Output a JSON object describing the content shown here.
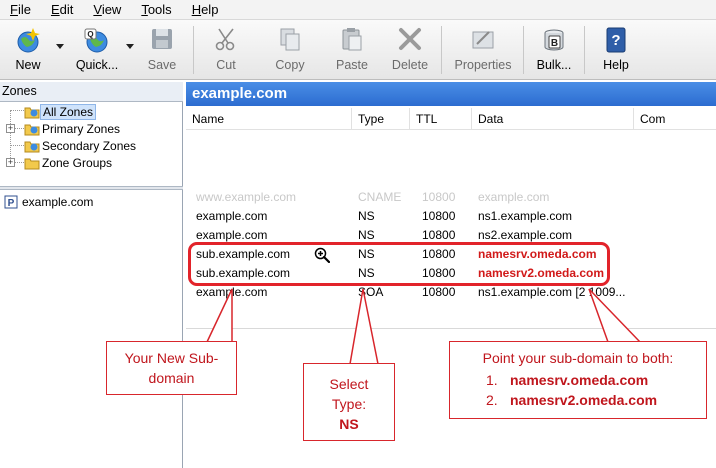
{
  "menu": [
    {
      "first": "F",
      "rest": "ile"
    },
    {
      "first": "E",
      "rest": "dit"
    },
    {
      "first": "V",
      "rest": "iew"
    },
    {
      "first": "T",
      "rest": "ools"
    },
    {
      "first": "H",
      "rest": "elp"
    }
  ],
  "toolbar": {
    "new": "New",
    "quick": "Quick...",
    "save": "Save",
    "cut": "Cut",
    "copy": "Copy",
    "paste": "Paste",
    "delete": "Delete",
    "properties": "Properties",
    "bulk": "Bulk...",
    "help": "Help"
  },
  "left": {
    "header": "Zones",
    "tree": {
      "all_zones": "All Zones",
      "primary_zones": "Primary Zones",
      "secondary_zones": "Secondary Zones",
      "zone_groups": "Zone Groups"
    },
    "server": "example.com"
  },
  "right": {
    "title": "example.com",
    "columns": [
      "Name",
      "Type",
      "TTL",
      "Data",
      "Com"
    ],
    "rows": [
      {
        "name": "www.example.com",
        "type": "CNAME",
        "ttl": "10800",
        "data": "example.com"
      },
      {
        "name": "example.com",
        "type": "NS",
        "ttl": "10800",
        "data": "ns1.example.com"
      },
      {
        "name": "example.com",
        "type": "NS",
        "ttl": "10800",
        "data": "ns2.example.com"
      },
      {
        "name": "sub.example.com",
        "type": "NS",
        "ttl": "10800",
        "data": "namesrv.omeda.com"
      },
      {
        "name": "sub.example.com",
        "type": "NS",
        "ttl": "10800",
        "data": "namesrv2.omeda.com"
      },
      {
        "name": "example.com",
        "type": "SOA",
        "ttl": "10800",
        "data": "ns1.example.com [2 1009..."
      }
    ]
  },
  "callouts": {
    "new_subdomain": {
      "line1": "Your New Sub-",
      "line2": "domain"
    },
    "select_type": {
      "line1": "Select",
      "line2": "Type:",
      "line3": "NS"
    },
    "point": {
      "heading": "Point your sub-domain to both:",
      "items": [
        {
          "num": "1.",
          "value": "namesrv.omeda.com"
        },
        {
          "num": "2.",
          "value": "namesrv2.omeda.com"
        }
      ]
    }
  },
  "colors": {
    "annotation_red": "#e2232a",
    "title_blue": "#2c6cd0",
    "highlight_text_red": "#d11a1a"
  }
}
